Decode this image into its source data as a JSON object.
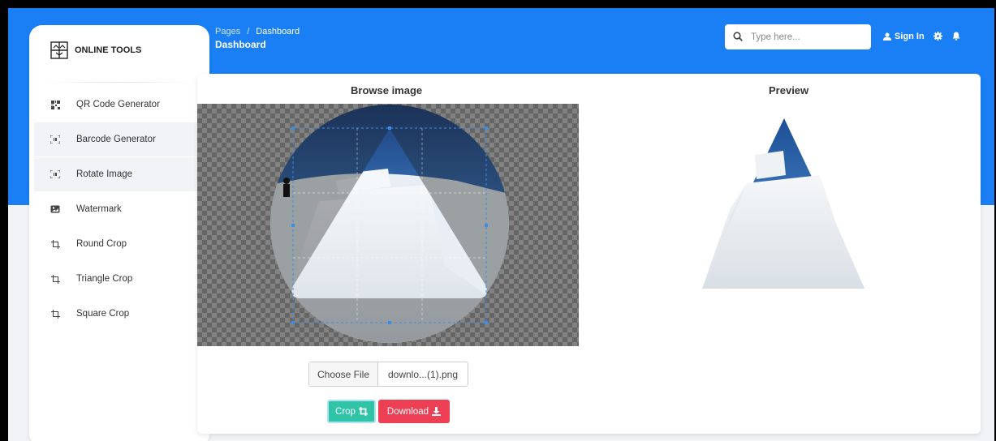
{
  "brand": {
    "name": "ONLINE TOOLS",
    "icon": "layout-grid-icon"
  },
  "sidebar": {
    "items": [
      {
        "label": "QR Code Generator",
        "icon": "qr-code-icon"
      },
      {
        "label": "Barcode Generator",
        "icon": "barcode-icon"
      },
      {
        "label": "Rotate Image",
        "icon": "barcode-icon"
      },
      {
        "label": "Watermark",
        "icon": "image-icon"
      },
      {
        "label": "Round Crop",
        "icon": "crop-icon"
      },
      {
        "label": "Triangle Crop",
        "icon": "crop-icon"
      },
      {
        "label": "Square Crop",
        "icon": "crop-icon"
      }
    ]
  },
  "header": {
    "breadcrumb_root": "Pages",
    "breadcrumb_separator": "/",
    "breadcrumb_current": "Dashboard",
    "title": "Dashboard",
    "search_placeholder": "Type here...",
    "signin_label": "Sign In"
  },
  "main": {
    "browse_title": "Browse image",
    "preview_title": "Preview",
    "choose_file_label": "Choose File",
    "file_name": "downlo...(1).png",
    "crop_label": "Crop",
    "download_label": "Download"
  },
  "colors": {
    "accent": "#1a7ff5",
    "crop_button": "#2ec4a5",
    "download_button": "#ee4055"
  }
}
